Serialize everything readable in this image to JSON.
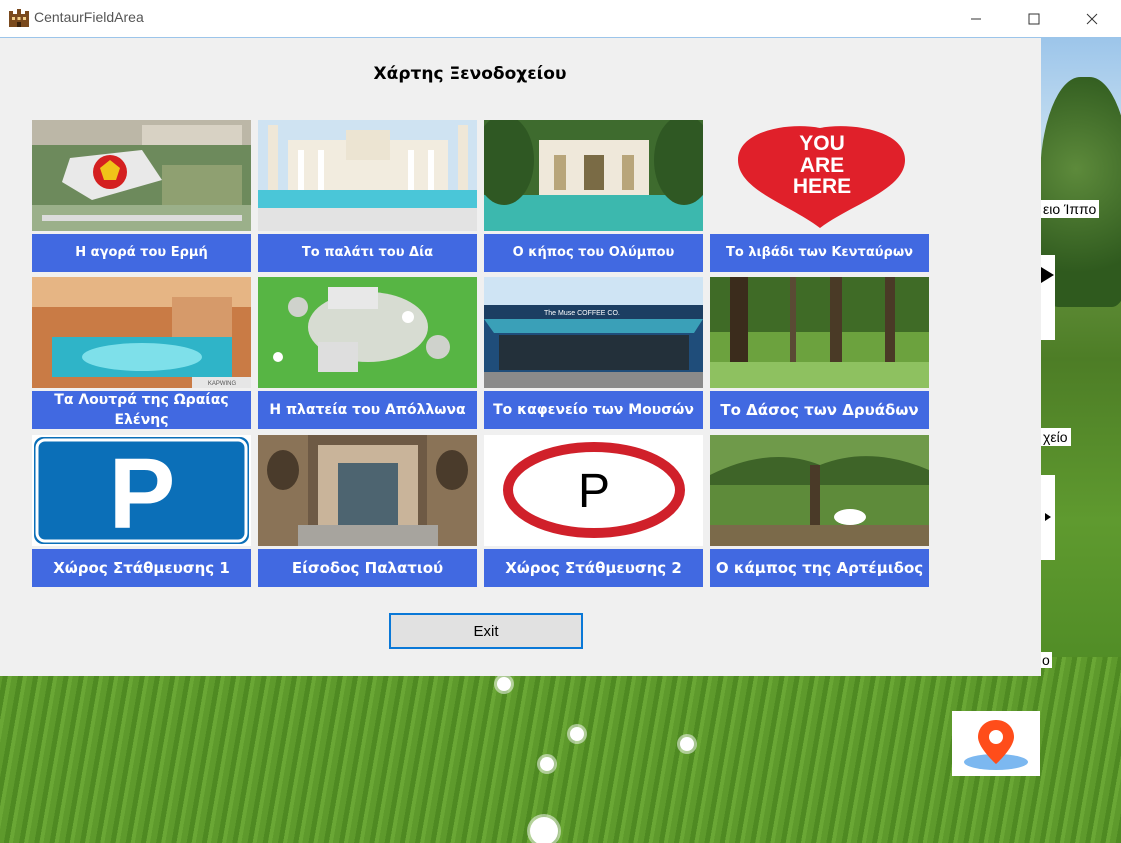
{
  "window": {
    "title": "CentaurFieldArea",
    "icon": "castle-icon"
  },
  "dialog": {
    "title": "Χάρτης Ξενοδοχείου",
    "exit_label": "Exit"
  },
  "tiles": [
    {
      "label": "Η αγορά του Ερμή"
    },
    {
      "label": "Το παλάτι του Δία"
    },
    {
      "label": "Ο κήπος του Ολύμπου"
    },
    {
      "label": "Το λιβάδι των Κενταύρων",
      "image_text": [
        "YOU",
        "ARE",
        "HERE"
      ]
    },
    {
      "label": "Τα Λουτρά της Ωραίας Ελένης",
      "image_text": "KAPWING"
    },
    {
      "label": "Η πλατεία του Απόλλωνα"
    },
    {
      "label": "Το καφενείο των Μουσών",
      "image_text": "The Muse COFFEE CO."
    },
    {
      "label": "Το Δάσος των Δρυάδων"
    },
    {
      "label": "Χώρος Στάθμευσης 1",
      "image_text": "P"
    },
    {
      "label": "Είσοδος Παλατιού"
    },
    {
      "label": "Χώρος Στάθμευσης 2",
      "image_text": "P"
    },
    {
      "label": "Ο κάμπος της Αρτέμιδος"
    }
  ],
  "background_fragments": {
    "frag1": "ειο Ίππο",
    "frag2": "χείο",
    "frag3": "ο"
  },
  "colors": {
    "tile_label_bg": "#4169e1",
    "dialog_bg": "#f0f0f0",
    "exit_border": "#0a78d7",
    "heart_red": "#e0202a",
    "parking_blue": "#0b6fb8",
    "parking_red_ring": "#d0202a",
    "map_pin": "#ff4d1a"
  }
}
